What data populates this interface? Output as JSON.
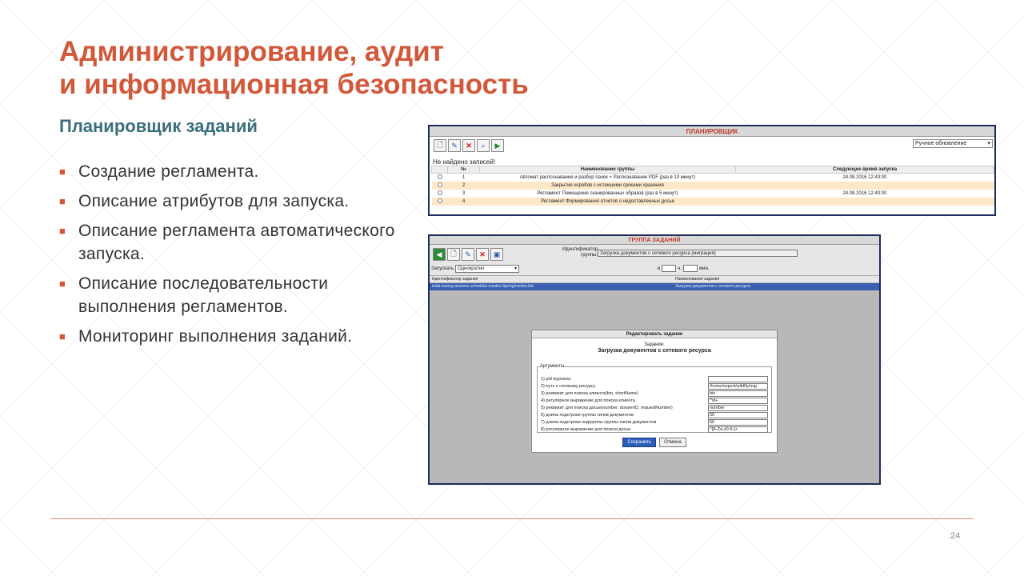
{
  "slide": {
    "title_line1": "Администрирование, аудит",
    "title_line2": "и информационная безопасность",
    "subtitle": "Планировщик заданий",
    "bullets": [
      "Создание регламента.",
      "Описание атрибутов для запуска.",
      "Описание регламента автоматического запуска.",
      "Описание последовательности выполнения регламентов.",
      "Мониторинг выполнения заданий."
    ],
    "page_number": "24",
    "colors": {
      "title": "#d25839",
      "subtitle": "#3b6e7c",
      "bullet_mark": "#d25839"
    }
  },
  "scheduler": {
    "title": "ПЛАНИРОВЩИК",
    "refresh_select": "Ручное обновление",
    "empty_text": "Не найдено записей!",
    "columns": [
      "№",
      "Наименование группы",
      "Следующее время запуска"
    ],
    "rows": [
      {
        "num": "1",
        "name": "Автомат распознавание и разбор пачек + Распознавание PDF (раз в 10 минут)",
        "next": "24.08.2016 12:43:00"
      },
      {
        "num": "2",
        "name": "Закрытие коробов с истекшими сроками хранения",
        "next": ""
      },
      {
        "num": "3",
        "name": "Регламент Помещение сканированных образов (раз в 5 минут)",
        "next": "24.08.2016 12:40:00"
      },
      {
        "num": "4",
        "name": "Регламент Формирования отчетов о недоставленных досье",
        "next": ""
      }
    ]
  },
  "group": {
    "title": "ГРУППА ЗАДАНИЙ",
    "id_label": "Идентификатор группы:",
    "id_value": "Загрузка документов с сетевого ресурса (миграция)",
    "run_label": "Запускать",
    "run_value": "Однократно",
    "time_in": "в",
    "time_h": "ч.",
    "time_min": "мин.",
    "col_id": "Идентификатор задания",
    "col_name": "Наименование задания",
    "row_id": "isida.esrorg.sessions.scheduler.invoker.SpringInvokerJob",
    "row_name": "Загрузка документов с сетевого ресурса",
    "dialog": {
      "title": "Редактировать задание",
      "task_label": "Задание:",
      "task_name": "Загрузка документов с сетевого ресурса",
      "legend": "Аргументы",
      "args": [
        {
          "label": "1) pid журнала",
          "value": ""
        },
        {
          "label": "2) путь к сетевому ресурсу",
          "value": "/home/export/wildfly/mig"
        },
        {
          "label": "3) реквизит для поиска клиента(bin, shortName)",
          "value": "bin"
        },
        {
          "label": "4) регулярное выражение для поиска клиента",
          "value": "^\\d+"
        },
        {
          "label": "5) реквизит для поиска досье(number, dossierID, requestNumber)",
          "value": "number"
        },
        {
          "label": "6) длина подстроки группы типов документов",
          "value": "50"
        },
        {
          "label": "7) длина подстроки подгруппы группы типов документов",
          "value": "50"
        },
        {
          "label": "8) регулярное выражение для поиска досье",
          "value": "^[A-Za-z0-9-]+"
        }
      ],
      "save": "Сохранить",
      "cancel": "Отмена"
    }
  }
}
